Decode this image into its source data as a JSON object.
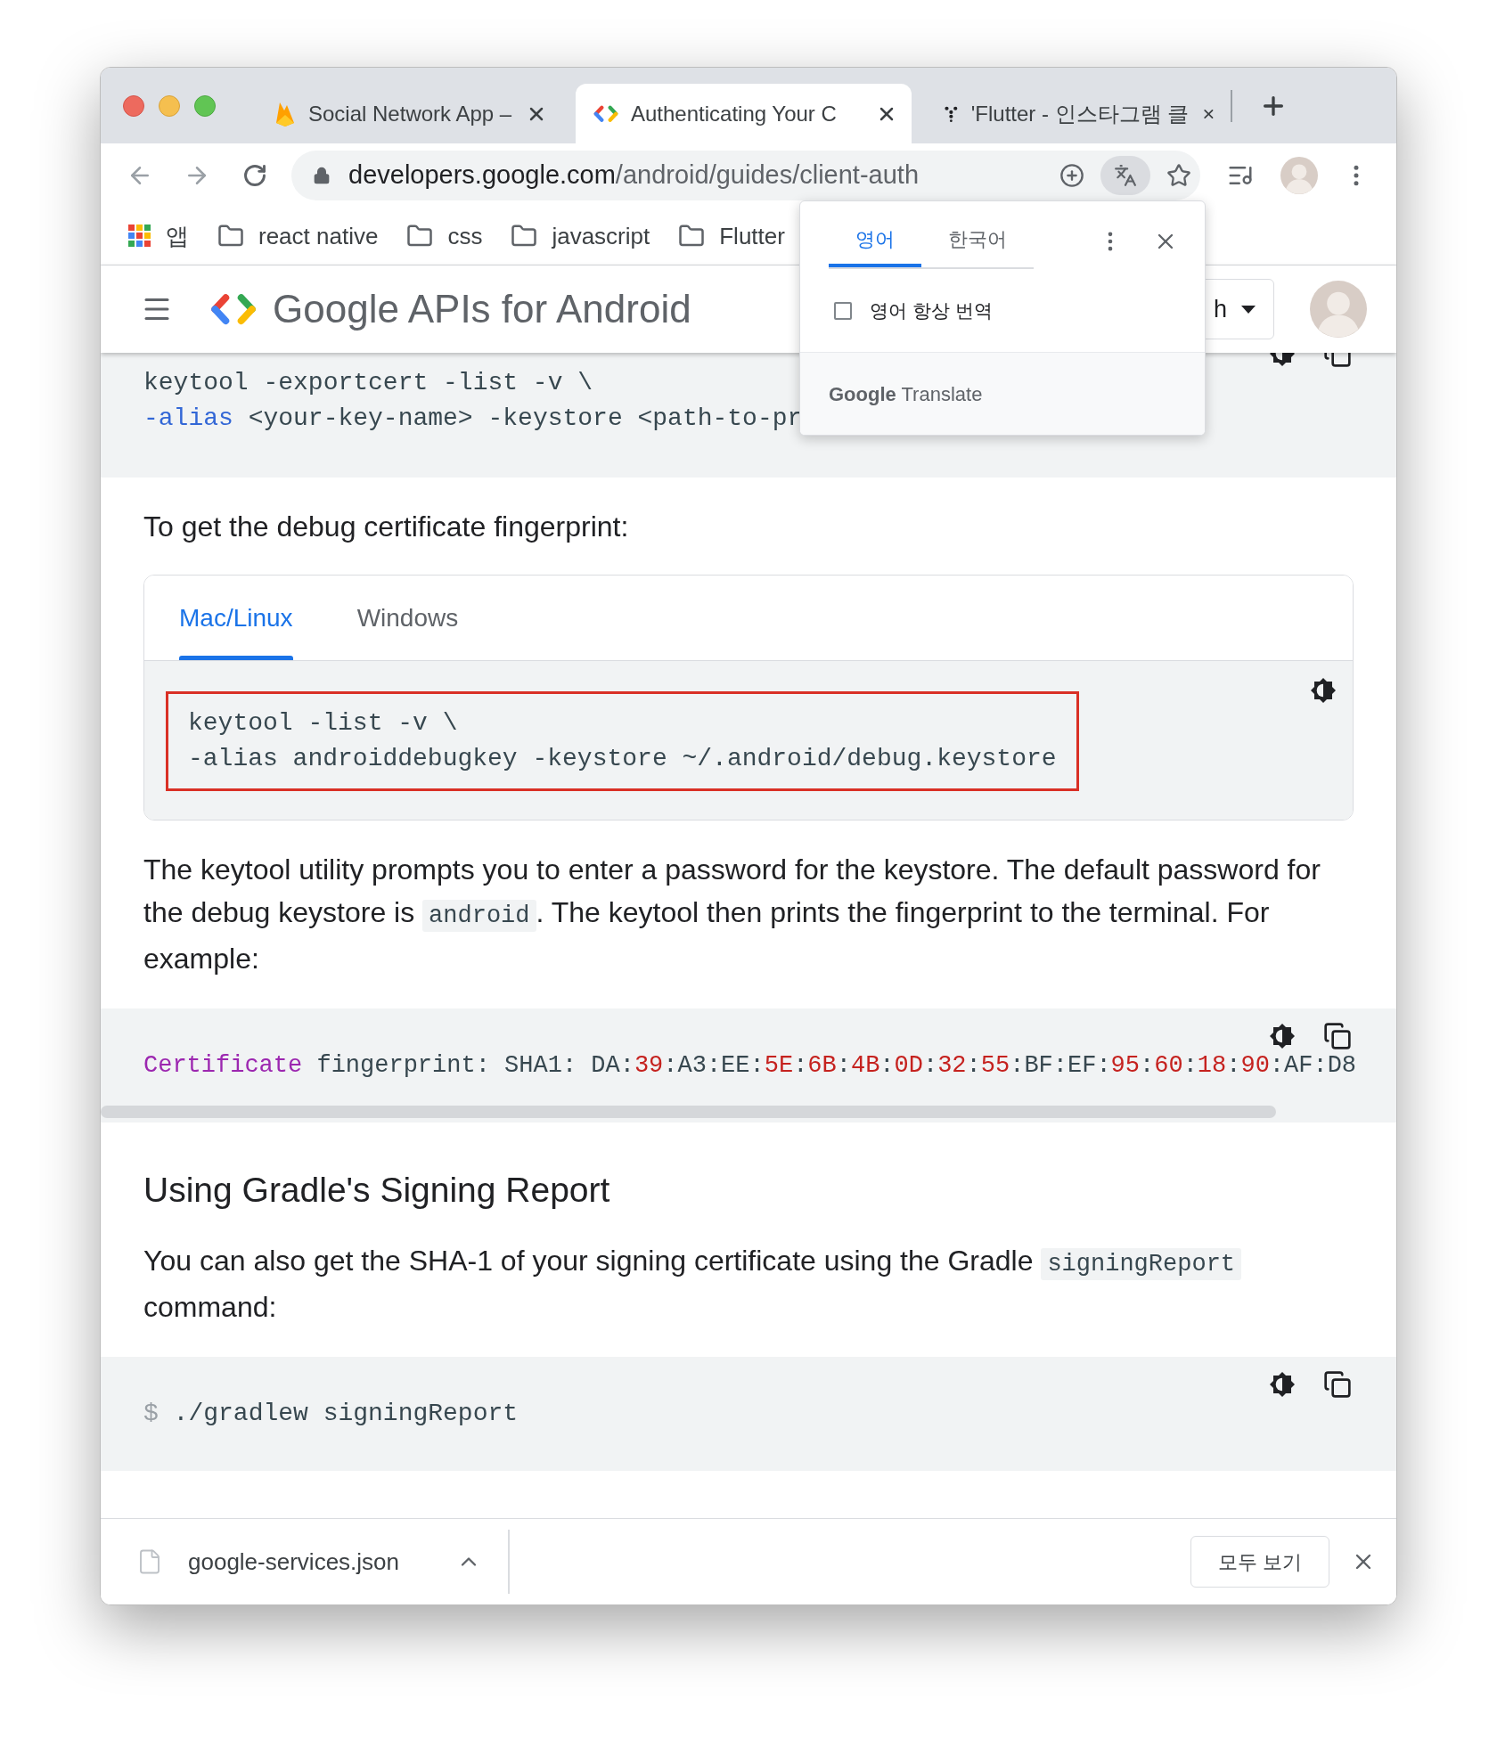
{
  "browser_tabs": [
    {
      "title": "Social Network App –",
      "selected": false
    },
    {
      "title": "Authenticating Your C",
      "selected": true
    },
    {
      "title": "'Flutter - 인스타그램 클",
      "selected": false
    }
  ],
  "address_bar": {
    "domain": "developers.google.com",
    "path": "/android/guides/client-auth"
  },
  "bookmarks": [
    {
      "label": "앱",
      "kind": "apps"
    },
    {
      "label": "react native",
      "kind": "folder"
    },
    {
      "label": "css",
      "kind": "folder"
    },
    {
      "label": "javascript",
      "kind": "folder"
    },
    {
      "label": "Flutter",
      "kind": "folder"
    }
  ],
  "site_header": {
    "title": "Google APIs for Android",
    "language": "h"
  },
  "translate_popup": {
    "tabs": [
      {
        "label": "영어",
        "selected": true
      },
      {
        "label": "한국어",
        "selected": false
      }
    ],
    "always_translate": {
      "label": "영어 항상 번역",
      "checked": false
    },
    "footer": "**Google** Translate"
  },
  "blocks": [
    {
      "kind": "code",
      "lines": [
        [
          {
            "text": "keytool -exportcert -list -v \\",
            "kind": "plain"
          }
        ],
        [
          {
            "text": "-alias",
            "kind": "literal"
          },
          {
            "text": " <your-key-name> -keystore <path-to-pr",
            "kind": "plain"
          }
        ]
      ]
    },
    {
      "kind": "paragraph",
      "parts": [
        {
          "text": "To get the debug certificate fingerprint:",
          "code": false
        }
      ]
    },
    {
      "kind": "tabbed_code",
      "tabs": [
        {
          "label": "Mac/Linux",
          "selected": true
        },
        {
          "label": "Windows",
          "selected": false
        }
      ],
      "highlighted": true,
      "lines": [
        [
          {
            "text": "keytool -list -v \\",
            "kind": "plain"
          }
        ],
        [
          {
            "text": "-alias androiddebugkey -keystore ~/.android/debug.keystore",
            "kind": "plain"
          }
        ]
      ]
    },
    {
      "kind": "paragraph",
      "parts": [
        {
          "text": "The keytool utility prompts you to enter a password for the keystore. The default password for the debug keystore is ",
          "code": false
        },
        {
          "text": "android",
          "code": true
        },
        {
          "text": ". The keytool then prints the fingerprint to the terminal. For example:",
          "code": false
        }
      ]
    },
    {
      "kind": "code_scrollable",
      "lines": [
        [
          {
            "text": "Certificate",
            "kind": "keyword"
          },
          {
            "text": " fingerprint: SHA1: DA:",
            "kind": "plain"
          },
          {
            "text": "39",
            "kind": "number"
          },
          {
            "text": ":A3:EE:",
            "kind": "plain"
          },
          {
            "text": "5E",
            "kind": "number"
          },
          {
            "text": ":",
            "kind": "plain"
          },
          {
            "text": "6B",
            "kind": "number"
          },
          {
            "text": ":",
            "kind": "plain"
          },
          {
            "text": "4B",
            "kind": "number"
          },
          {
            "text": ":",
            "kind": "plain"
          },
          {
            "text": "0D",
            "kind": "number"
          },
          {
            "text": ":",
            "kind": "plain"
          },
          {
            "text": "32",
            "kind": "number"
          },
          {
            "text": ":",
            "kind": "plain"
          },
          {
            "text": "55",
            "kind": "number"
          },
          {
            "text": ":BF:EF:",
            "kind": "plain"
          },
          {
            "text": "95",
            "kind": "number"
          },
          {
            "text": ":",
            "kind": "plain"
          },
          {
            "text": "60",
            "kind": "number"
          },
          {
            "text": ":",
            "kind": "plain"
          },
          {
            "text": "18",
            "kind": "number"
          },
          {
            "text": ":",
            "kind": "plain"
          },
          {
            "text": "90",
            "kind": "number"
          },
          {
            "text": ":AF:D8",
            "kind": "plain"
          }
        ]
      ]
    },
    {
      "kind": "heading",
      "text": "Using Gradle's Signing Report"
    },
    {
      "kind": "paragraph",
      "parts": [
        {
          "text": "You can also get the SHA-1 of your signing certificate using the Gradle ",
          "code": false
        },
        {
          "text": "signingReport",
          "code": true
        },
        {
          "text": " command:",
          "code": false
        }
      ]
    },
    {
      "kind": "code",
      "lines": [
        [
          {
            "text": "$",
            "kind": "prompt"
          },
          {
            "text": " ./gradlew signingReport",
            "kind": "plain"
          }
        ]
      ]
    }
  ],
  "download_bar": {
    "file": "google-services.json",
    "show_all": "모두 보기"
  }
}
